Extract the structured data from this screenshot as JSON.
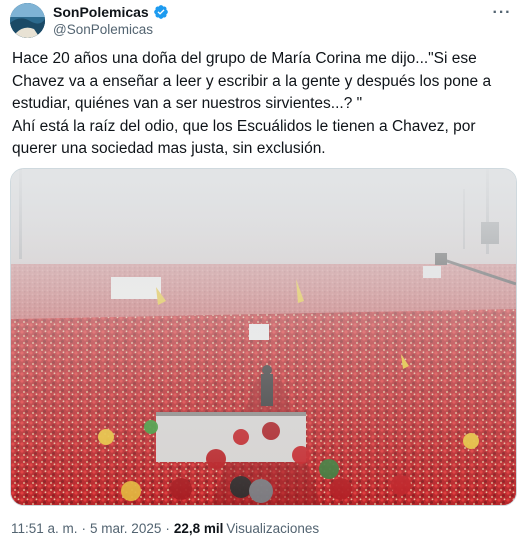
{
  "author": {
    "display_name": "SonPolemicas",
    "handle": "@SonPolemicas",
    "verified": true,
    "avatar_icon": "avatar-image"
  },
  "more_icon": "more-options-icon",
  "tweet": {
    "text": "Hace 20 años una doña del grupo de María Corina me dijo...\"Si ese\nChavez va a enseñar a leer y escribir a la gente y después los pone a\nestudiar, quiénes van a ser nuestros sirvientes...? \"\nAhí está la raíz del odio, que los Escuálidos le tienen a Chavez, por\nquerer una sociedad mas justa, sin exclusión."
  },
  "media": {
    "type": "photo",
    "subject": "crowd-rally-photo"
  },
  "meta": {
    "time": "11:51 a. m.",
    "date": "5 mar. 2025",
    "views_count": "22,8 mil",
    "views_label": "Visualizaciones",
    "separator": "·"
  },
  "colors": {
    "verified": "#1d9bf0",
    "secondary_text": "#536471",
    "primary_text": "#0f1419",
    "crowd_red": "#c0262b"
  }
}
